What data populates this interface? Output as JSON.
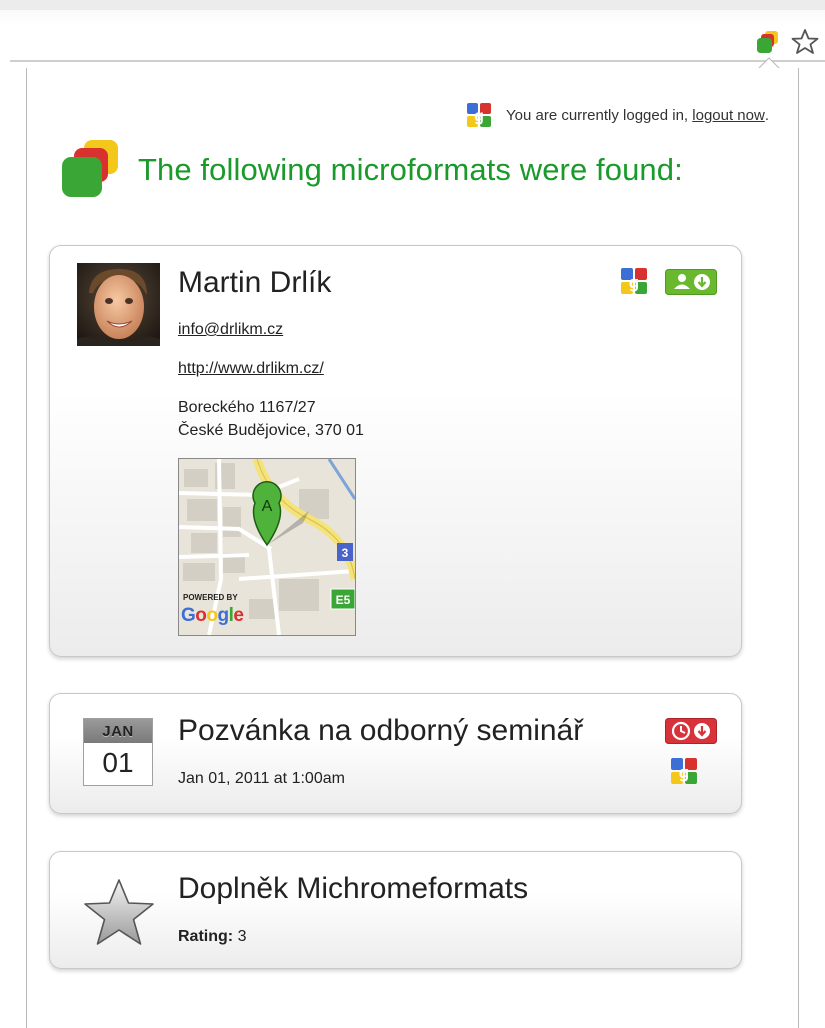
{
  "login": {
    "message": "You are currently logged in,",
    "logout_label": "logout now",
    "trailing": "."
  },
  "header": {
    "title": "The following microformats were found:"
  },
  "contact": {
    "name": "Martin Drlík",
    "email": "info@drlikm.cz",
    "url": "http://www.drlikm.cz/",
    "address_line1": "Boreckého 1167/27",
    "address_line2": "České Budějovice, 370 01",
    "map": {
      "marker_label": "A",
      "road_label_1": "3",
      "road_label_2": "E5",
      "powered_by": "POWERED BY",
      "google": "Google"
    },
    "icons": [
      "google-icon",
      "add-contact-icon"
    ]
  },
  "event": {
    "title": "Pozvánka na odborný seminář",
    "date_text": "Jan 01, 2011 at 1:00am",
    "cal_month": "JAN",
    "cal_day": "01",
    "icons": [
      "add-event-icon",
      "google-icon"
    ]
  },
  "review": {
    "title": "Doplněk Michromeformats",
    "rating_label": "Rating:",
    "rating_value": "3"
  },
  "colors": {
    "header_green": "#1a9a2a",
    "contact_button_green": "#6ab82e",
    "event_button_red": "#d8333b"
  }
}
